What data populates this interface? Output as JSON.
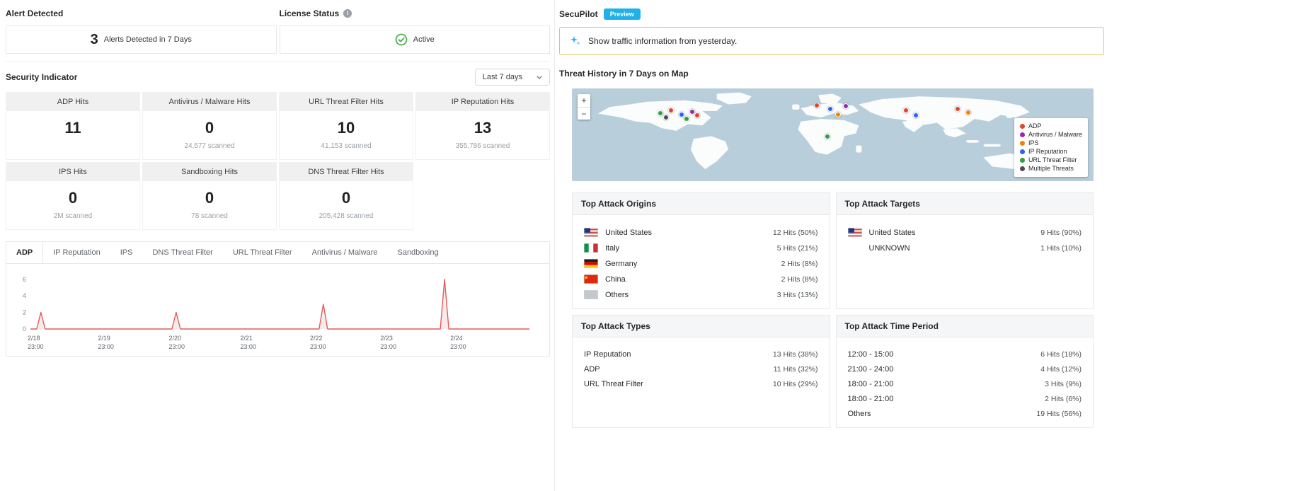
{
  "alert": {
    "title": "Alert Detected",
    "count": "3",
    "label": "Alerts Detected in 7 Days"
  },
  "license": {
    "title": "License Status",
    "status": "Active"
  },
  "security_indicator": {
    "title": "Security Indicator",
    "range_label": "Last 7 days",
    "cards": [
      {
        "title": "ADP Hits",
        "value": "11",
        "sub": ""
      },
      {
        "title": "Antivirus / Malware Hits",
        "value": "0",
        "sub": "24,577 scanned"
      },
      {
        "title": "URL Threat Filter Hits",
        "value": "10",
        "sub": "41,153 scanned"
      },
      {
        "title": "IP Reputation Hits",
        "value": "13",
        "sub": "355,786 scanned"
      },
      {
        "title": "IPS Hits",
        "value": "0",
        "sub": "2M scanned"
      },
      {
        "title": "Sandboxing Hits",
        "value": "0",
        "sub": "78 scanned"
      },
      {
        "title": "DNS Threat Filter Hits",
        "value": "0",
        "sub": "205,428 scanned"
      }
    ]
  },
  "tabs": {
    "active": "ADP",
    "items": [
      "ADP",
      "IP Reputation",
      "IPS",
      "DNS Threat Filter",
      "URL Threat Filter",
      "Antivirus / Malware",
      "Sandboxing"
    ]
  },
  "chart_data": {
    "type": "line",
    "title": "ADP hits over last 7 days",
    "series": [
      {
        "name": "ADP Hits",
        "color": "#e25c5c",
        "spikes": [
          {
            "pos": 0.021,
            "value": 2
          },
          {
            "pos": 0.292,
            "value": 2
          },
          {
            "pos": 0.587,
            "value": 3
          },
          {
            "pos": 0.83,
            "value": 6
          }
        ],
        "baseline": 0
      }
    ],
    "x_ticks": [
      {
        "date": "2/18",
        "time": "23:00",
        "pos": 0.0
      },
      {
        "date": "2/19",
        "time": "23:00",
        "pos": 0.141
      },
      {
        "date": "2/20",
        "time": "23:00",
        "pos": 0.283
      },
      {
        "date": "2/21",
        "time": "23:00",
        "pos": 0.426
      },
      {
        "date": "2/22",
        "time": "23:00",
        "pos": 0.566
      },
      {
        "date": "2/23",
        "time": "23:00",
        "pos": 0.707
      },
      {
        "date": "2/24",
        "time": "23:00",
        "pos": 0.847
      }
    ],
    "y_ticks": [
      0,
      2,
      4,
      6
    ],
    "ylim": [
      0,
      6.5
    ],
    "grid": false,
    "legend_position": "none"
  },
  "secupilot": {
    "title": "SecuPilot",
    "badge": "Preview",
    "suggestion": "Show traffic information from yesterday."
  },
  "map": {
    "title": "Threat History in 7 Days on Map",
    "zoom_in": "+",
    "zoom_out": "−",
    "ocean_color": "#b9cedb",
    "land_color": "#fbfcfc",
    "legend": [
      {
        "label": "ADP",
        "color": "#e2442e"
      },
      {
        "label": "Antivirus / Malware",
        "color": "#9c27b0"
      },
      {
        "label": "IPS",
        "color": "#f08300"
      },
      {
        "label": "IP Reputation",
        "color": "#2962ff"
      },
      {
        "label": "URL Threat Filter",
        "color": "#2e9e44"
      },
      {
        "label": "Multiple Threats",
        "color": "#4d4d4d"
      }
    ],
    "markers": [
      {
        "x": 17,
        "y": 27,
        "type": "URL Threat Filter"
      },
      {
        "x": 19,
        "y": 24,
        "type": "ADP"
      },
      {
        "x": 21,
        "y": 28,
        "type": "IP Reputation"
      },
      {
        "x": 23,
        "y": 25,
        "type": "Antivirus / Malware"
      },
      {
        "x": 24,
        "y": 29,
        "type": "ADP"
      },
      {
        "x": 18,
        "y": 31,
        "type": "Multiple Threats"
      },
      {
        "x": 22,
        "y": 33,
        "type": "URL Threat Filter"
      },
      {
        "x": 47,
        "y": 18,
        "type": "ADP"
      },
      {
        "x": 49.5,
        "y": 22,
        "type": "IP Reputation"
      },
      {
        "x": 51,
        "y": 28,
        "type": "IPS"
      },
      {
        "x": 52.5,
        "y": 19,
        "type": "Antivirus / Malware"
      },
      {
        "x": 64,
        "y": 24,
        "type": "ADP"
      },
      {
        "x": 66,
        "y": 29,
        "type": "IP Reputation"
      },
      {
        "x": 74,
        "y": 22,
        "type": "ADP"
      },
      {
        "x": 76,
        "y": 26,
        "type": "IPS"
      },
      {
        "x": 49,
        "y": 52,
        "type": "URL Threat Filter"
      }
    ]
  },
  "attack_panels": [
    {
      "id": "origins",
      "title": "Top Attack Origins",
      "rows": [
        {
          "flag": "us",
          "label": "United States",
          "hits": "12 Hits (50%)"
        },
        {
          "flag": "it",
          "label": "Italy",
          "hits": "5 Hits (21%)"
        },
        {
          "flag": "de",
          "label": "Germany",
          "hits": "2 Hits (8%)"
        },
        {
          "flag": "cn",
          "label": "China",
          "hits": "2 Hits (8%)"
        },
        {
          "flag": "other",
          "label": "Others",
          "hits": "3 Hits (13%)"
        }
      ]
    },
    {
      "id": "targets",
      "title": "Top Attack Targets",
      "rows": [
        {
          "flag": "us",
          "label": "United States",
          "hits": "9 Hits (90%)"
        },
        {
          "flag": "none",
          "label": "UNKNOWN",
          "hits": "1 Hits (10%)"
        }
      ]
    },
    {
      "id": "types",
      "title": "Top Attack Types",
      "rows": [
        {
          "flag": null,
          "label": "IP Reputation",
          "hits": "13 Hits (38%)"
        },
        {
          "flag": null,
          "label": "ADP",
          "hits": "11 Hits (32%)"
        },
        {
          "flag": null,
          "label": "URL Threat Filter",
          "hits": "10 Hits (29%)"
        }
      ]
    },
    {
      "id": "time_period",
      "title": "Top Attack Time Period",
      "rows": [
        {
          "flag": null,
          "label": "12:00 - 15:00",
          "hits": "6 Hits (18%)"
        },
        {
          "flag": null,
          "label": "21:00 - 24:00",
          "hits": "4 Hits (12%)"
        },
        {
          "flag": null,
          "label": "18:00 - 21:00",
          "hits": "3 Hits (9%)"
        },
        {
          "flag": null,
          "label": "18:00 - 21:00",
          "hits": "2 Hits (6%)"
        },
        {
          "flag": null,
          "label": "Others",
          "hits": "19 Hits (56%)"
        }
      ]
    }
  ]
}
